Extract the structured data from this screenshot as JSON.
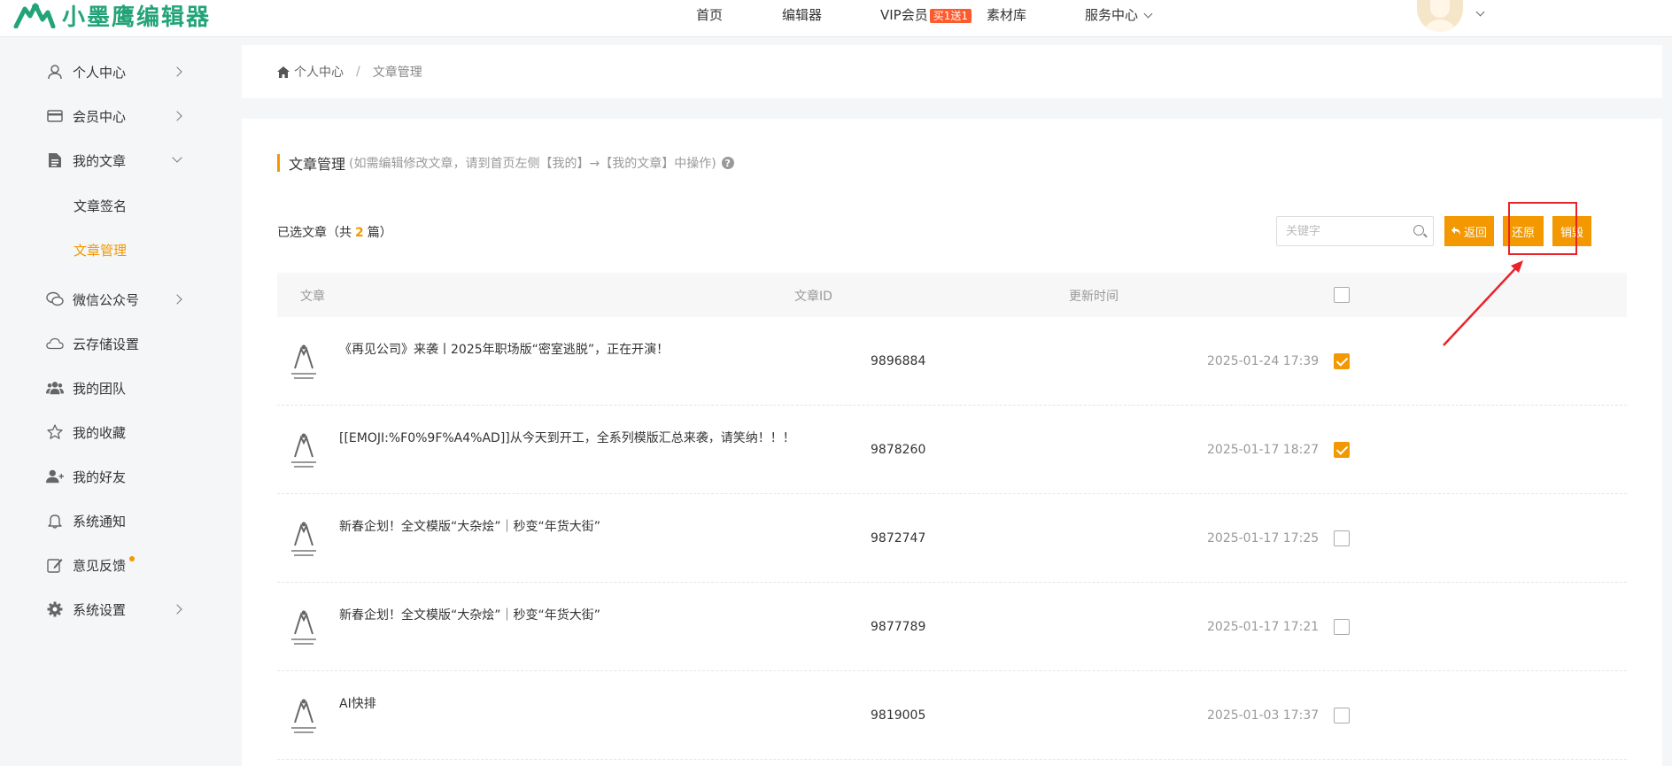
{
  "header": {
    "logo_text": "小墨鹰编辑器",
    "nav": {
      "home": "首页",
      "editor": "编辑器",
      "vip": "VIP会员",
      "vip_badge": "买1送1",
      "materials": "素材库",
      "service": "服务中心"
    }
  },
  "sidebar": {
    "items": [
      {
        "label": "个人中心",
        "icon": "user-icon"
      },
      {
        "label": "会员中心",
        "icon": "card-icon"
      },
      {
        "label": "我的文章",
        "icon": "document-icon"
      },
      {
        "label": "微信公众号",
        "icon": "wechat-icon"
      },
      {
        "label": "云存储设置",
        "icon": "cloud-icon"
      },
      {
        "label": "我的团队",
        "icon": "team-icon"
      },
      {
        "label": "我的收藏",
        "icon": "star-icon"
      },
      {
        "label": "我的好友",
        "icon": "add-friend-icon"
      },
      {
        "label": "系统通知",
        "icon": "bell-icon"
      },
      {
        "label": "意见反馈",
        "icon": "edit-icon"
      },
      {
        "label": "系统设置",
        "icon": "gear-icon"
      }
    ],
    "sub_items": [
      "文章签名",
      "文章管理"
    ]
  },
  "breadcrumb": {
    "home": "个人中心",
    "separator": "/",
    "current": "文章管理"
  },
  "main": {
    "title": "文章管理",
    "hint": "(如需编辑修改文章，请到首页左侧【我的】→【我的文章】中操作)",
    "help_icon": "?",
    "selected_prefix": "已选文章（共",
    "selected_count": "2",
    "selected_suffix": "篇）",
    "search_placeholder": "关键字",
    "buttons": {
      "back": "返回",
      "restore": "还原",
      "destroy": "销毁"
    },
    "table": {
      "headers": {
        "article": "文章",
        "id": "文章ID",
        "time": "更新时间"
      },
      "rows": [
        {
          "title": "《再见公司》来袭丨2025年职场版“密室逃脱”，正在开演！",
          "id": "9896884",
          "time": "2025-01-24 17:39",
          "checked": true
        },
        {
          "title": "[[EMOJI:%F0%9F%A4%AD]]从今天到开工，全系列模版汇总来袭，请笑纳！！！",
          "id": "9878260",
          "time": "2025-01-17 18:27",
          "checked": true
        },
        {
          "title": "新春企划！全文模版“大杂烩”｜秒变“年货大街”",
          "id": "9872747",
          "time": "2025-01-17 17:25",
          "checked": false
        },
        {
          "title": "新春企划！全文模版“大杂烩”｜秒变“年货大街”",
          "id": "9877789",
          "time": "2025-01-17 17:21",
          "checked": false
        },
        {
          "title": "AI快排",
          "id": "9819005",
          "time": "2025-01-03 17:37",
          "checked": false
        }
      ]
    }
  },
  "colors": {
    "accent": "#f39800",
    "brand_green": "#23a477",
    "highlight_red": "#e8232a"
  }
}
